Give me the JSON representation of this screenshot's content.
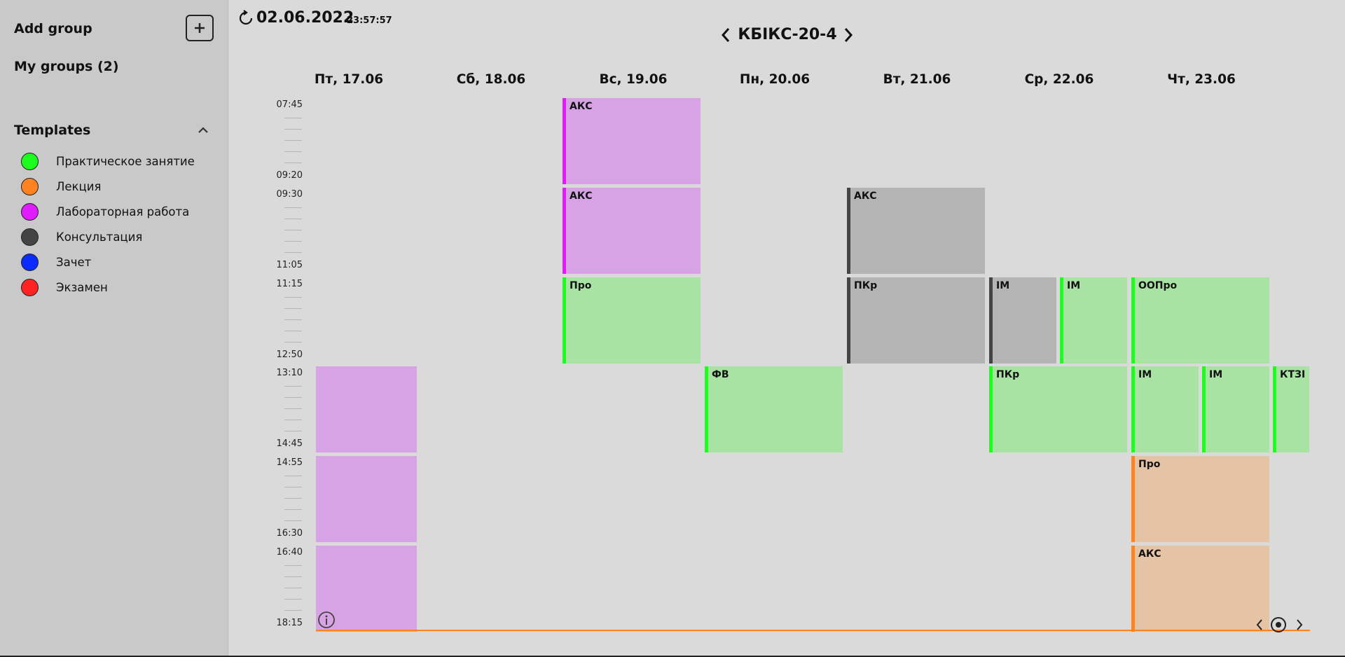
{
  "sidebar": {
    "add_group_label": "Add group",
    "my_groups_label": "My groups (2)",
    "templates_label": "Templates",
    "templates": [
      {
        "label": "Практическое занятие",
        "color": "#1cff1c"
      },
      {
        "label": "Лекция",
        "color": "#ff8320"
      },
      {
        "label": "Лабораторная работа",
        "color": "#e01cff"
      },
      {
        "label": "Консультация",
        "color": "#444444"
      },
      {
        "label": "Зачет",
        "color": "#0a2cff"
      },
      {
        "label": "Экзамен",
        "color": "#ff2424"
      }
    ]
  },
  "header": {
    "date": "02.06.2022",
    "time": "23:57:57",
    "group": "КБІКС-20-4"
  },
  "days": [
    "Пт, 17.06",
    "Сб, 18.06",
    "Вс, 19.06",
    "Пн, 20.06",
    "Вт, 21.06",
    "Ср, 22.06",
    "Чт, 23.06"
  ],
  "slots": [
    {
      "start": "07:45",
      "end": "09:20"
    },
    {
      "start": "09:30",
      "end": "11:05"
    },
    {
      "start": "11:15",
      "end": "12:50"
    },
    {
      "start": "13:10",
      "end": "14:45"
    },
    {
      "start": "14:55",
      "end": "16:30"
    },
    {
      "start": "16:40",
      "end": "18:15"
    }
  ],
  "events": [
    {
      "day": 0,
      "slot": 3,
      "title": "",
      "type": "lab",
      "col": 0,
      "cols": 1
    },
    {
      "day": 0,
      "slot": 4,
      "title": "",
      "type": "lab",
      "col": 0,
      "cols": 1
    },
    {
      "day": 0,
      "slot": 5,
      "title": "",
      "type": "lab",
      "col": 0,
      "cols": 1
    },
    {
      "day": 2,
      "slot": 0,
      "title": "АКС",
      "type": "lab",
      "col": 0,
      "cols": 1
    },
    {
      "day": 2,
      "slot": 1,
      "title": "АКС",
      "type": "lab",
      "col": 0,
      "cols": 1
    },
    {
      "day": 2,
      "slot": 2,
      "title": "Про",
      "type": "practice",
      "col": 0,
      "cols": 1
    },
    {
      "day": 3,
      "slot": 3,
      "title": "ФВ",
      "type": "practice",
      "col": 0,
      "cols": 1
    },
    {
      "day": 4,
      "slot": 1,
      "title": "АКС",
      "type": "consult",
      "col": 0,
      "cols": 1
    },
    {
      "day": 4,
      "slot": 2,
      "title": "ПКр",
      "type": "consult",
      "col": 0,
      "cols": 1
    },
    {
      "day": 5,
      "slot": 2,
      "title": "ІМ",
      "type": "consult",
      "col": 0,
      "cols": 2
    },
    {
      "day": 5,
      "slot": 2,
      "title": "ІМ",
      "type": "practice",
      "col": 1,
      "cols": 2
    },
    {
      "day": 5,
      "slot": 3,
      "title": "ПКр",
      "type": "practice",
      "col": 0,
      "cols": 1
    },
    {
      "day": 6,
      "slot": 2,
      "title": "ООПро",
      "type": "practice",
      "col": 0,
      "cols": 1
    },
    {
      "day": 6,
      "slot": 3,
      "title": "ІМ",
      "type": "practice",
      "col": 0,
      "cols": 2
    },
    {
      "day": 6,
      "slot": 3,
      "title": "ІМ",
      "type": "practice",
      "col": 1,
      "cols": 2
    },
    {
      "day": 6,
      "slot": 3,
      "title": "КТЗІ",
      "type": "practice",
      "col": 2,
      "cols": 2
    },
    {
      "day": 6,
      "slot": 4,
      "title": "Про",
      "type": "lecture",
      "col": 0,
      "cols": 1
    },
    {
      "day": 6,
      "slot": 5,
      "title": "АКС",
      "type": "lecture",
      "col": 0,
      "cols": 1
    }
  ],
  "event_styles": {
    "lab": {
      "bg": "#d8a3e4",
      "border": "#e01cff"
    },
    "practice": {
      "bg": "#a8e3a3",
      "border": "#1cff1c"
    },
    "consult": {
      "bg": "#b4b4b4",
      "border": "#444444"
    },
    "lecture": {
      "bg": "#e5c3a5",
      "border": "#ff8320"
    }
  },
  "icons": {
    "add": "plus-icon",
    "collapse": "chevron-up-icon",
    "refresh": "refresh-icon",
    "prev_group": "chevron-left-icon",
    "next_group": "chevron-right-icon",
    "info": "info-icon",
    "today": "target-icon"
  }
}
